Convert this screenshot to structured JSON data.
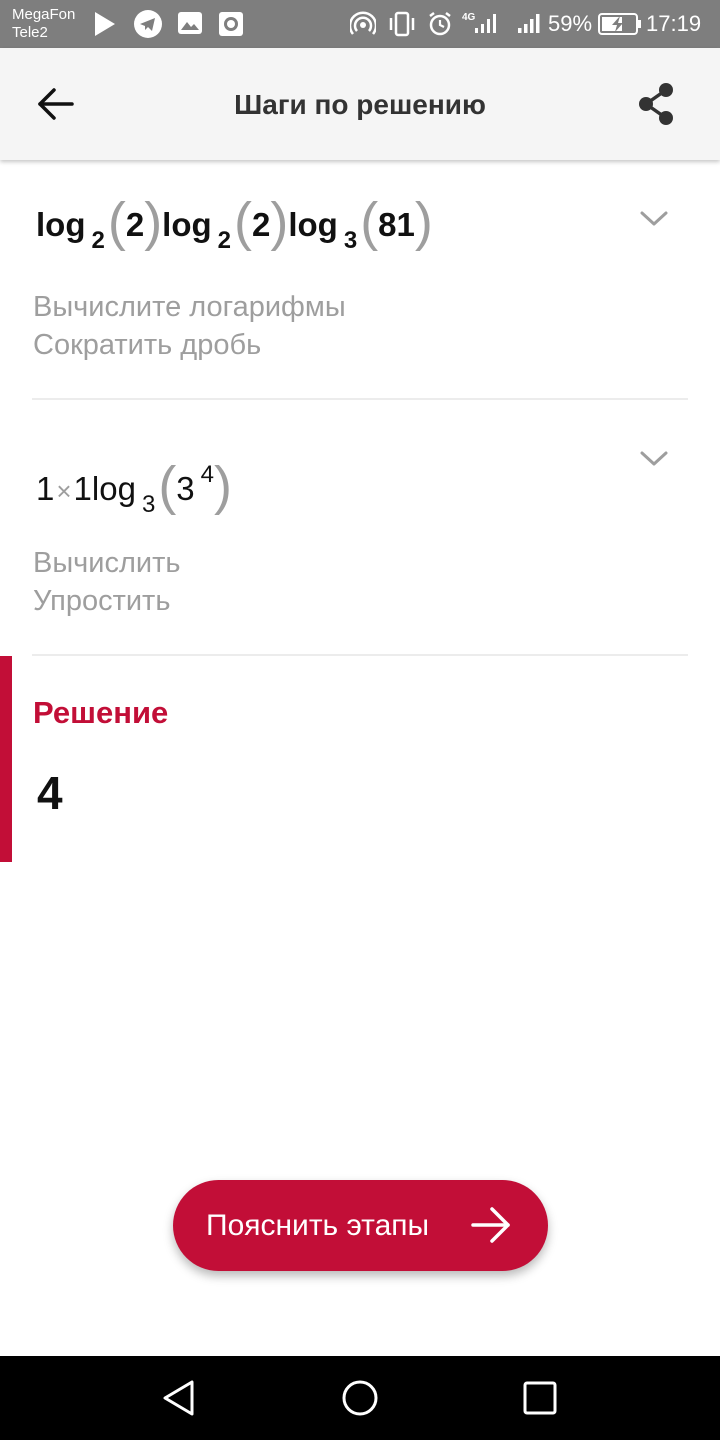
{
  "status_bar": {
    "carrier_1": "MegaFon",
    "carrier_2": "Tele2",
    "battery": "59%",
    "time": "17:19",
    "network": "4G",
    "icons": [
      "play-icon",
      "telegram-icon",
      "gallery-icon",
      "camera-icon",
      "hotspot-icon",
      "vibrate-icon",
      "alarm-icon",
      "signal-4g-icon",
      "signal-icon",
      "battery-icon"
    ]
  },
  "app_bar": {
    "title": "Шаги по решению",
    "back_icon": "arrow-back-icon",
    "share_icon": "share-icon"
  },
  "steps": [
    {
      "expression": {
        "t1_log": "log",
        "t1_base": "2",
        "t1_arg": "2",
        "t2_log": "log",
        "t2_base": "2",
        "t2_arg": "2",
        "t3_log": "log",
        "t3_base": "3",
        "t3_arg": "81"
      },
      "descriptions": [
        "Вычислите логарифмы",
        "Сократить дробь"
      ],
      "expand_icon": "chevron-down-icon"
    },
    {
      "expression": {
        "a": "1",
        "times": "×",
        "b": "1",
        "log": "log",
        "base": "3",
        "arg_base": "3",
        "arg_exp": "4"
      },
      "descriptions": [
        "Вычислить",
        "Упростить"
      ],
      "expand_icon": "chevron-down-icon"
    }
  ],
  "solution": {
    "label": "Решение",
    "value": "4"
  },
  "explain_button": {
    "label": "Пояснить этапы",
    "icon": "arrow-right-icon"
  },
  "colors": {
    "accent": "#c20e37",
    "status_bar": "#7e7e7e",
    "app_bar": "#f5f5f5",
    "muted_text": "#9e9e9e"
  },
  "nav_bar": {
    "icons": [
      "back-triangle-icon",
      "home-circle-icon",
      "recents-square-icon"
    ]
  }
}
